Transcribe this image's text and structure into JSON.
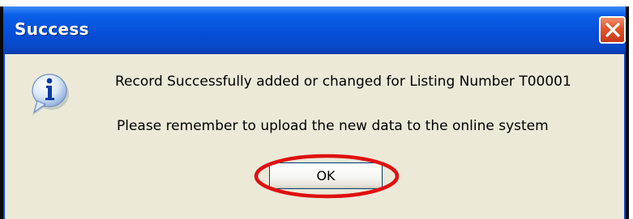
{
  "dialog": {
    "title": "Success",
    "message_line1": "Record Successfully added or changed for Listing Number T00001",
    "message_line2": "Please remember to upload the new data to the online system",
    "ok_label": "OK",
    "icon": "info-icon",
    "close_icon": "close-icon"
  },
  "colors": {
    "titlebar": "#0550d8",
    "dialog_body": "#ece9d8",
    "close_button": "#e0542a",
    "highlight_ellipse": "#e01010"
  }
}
